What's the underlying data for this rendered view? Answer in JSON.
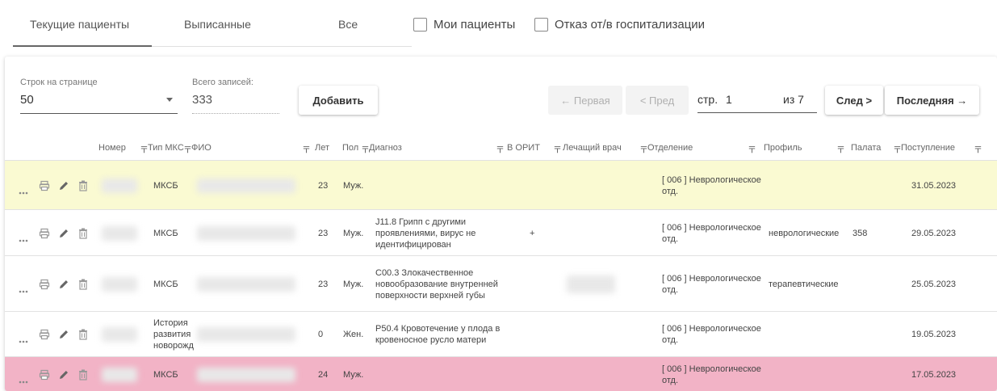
{
  "tabs": [
    {
      "label": "Текущие пациенты",
      "active": true
    },
    {
      "label": "Выписанные",
      "active": false
    },
    {
      "label": "Все",
      "active": false
    }
  ],
  "filters": {
    "my_patients": "Мои пациенты",
    "refusal": "Отказ от/в госпитализации"
  },
  "pager": {
    "rows_label": "Строк на странице",
    "rows_value": "50",
    "total_label": "Всего записей:",
    "total_value": "333",
    "add": "Добавить",
    "first": "← Первая",
    "prev": "< Пред",
    "page_label": "стр.",
    "page_value": "1",
    "of_label": "из 7",
    "next": "След >",
    "last": "Последняя →"
  },
  "columns": {
    "number": "Номер",
    "type": "Тип МКС",
    "fio": "ФИО",
    "age": "Лет",
    "sex": "Пол",
    "diagnosis": "Диагноз",
    "orit": "В ОРИТ",
    "doctor": "Лечащий врач",
    "department": "Отделение",
    "profile": "Профиль",
    "ward": "Палата",
    "admission": "Поступление"
  },
  "rows": [
    {
      "type": "МКСБ",
      "age": "23",
      "sex": "Муж.",
      "diagnosis": "",
      "orit": "",
      "department": "[ 006 ] Неврологическое отд.",
      "profile": "",
      "ward": "",
      "admission": "31.05.2023",
      "bg": "#fafad2"
    },
    {
      "type": "МКСБ",
      "age": "23",
      "sex": "Муж.",
      "diagnosis": "J11.8 Грипп с другими проявлениями, вирус не идентифицирован",
      "orit": "+",
      "department": "[ 006 ] Неврологическое отд.",
      "profile": "неврологические",
      "ward": "358",
      "admission": "29.05.2023",
      "bg": "#ffffff"
    },
    {
      "type": "МКСБ",
      "age": "23",
      "sex": "Муж.",
      "diagnosis": "C00.3 Злокачественное новообразование внутренней поверхности верхней губы",
      "orit": "",
      "department": "[ 006 ] Неврологическое отд.",
      "profile": "терапевтические",
      "ward": "",
      "admission": "25.05.2023",
      "bg": "#ffffff"
    },
    {
      "type": "История развития новорожд",
      "age": "0",
      "sex": "Жен.",
      "diagnosis": "P50.4 Кровотечение у плода в кровеносное русло матери",
      "orit": "",
      "department": "[ 006 ] Неврологическое отд.",
      "profile": "",
      "ward": "",
      "admission": "19.05.2023",
      "bg": "#ffffff"
    },
    {
      "type": "МКСБ",
      "age": "24",
      "sex": "Муж.",
      "diagnosis": "",
      "orit": "",
      "department": "[ 006 ] Неврологическое отд.",
      "profile": "",
      "ward": "",
      "admission": "17.05.2023",
      "bg": "#f2b3c6"
    }
  ]
}
